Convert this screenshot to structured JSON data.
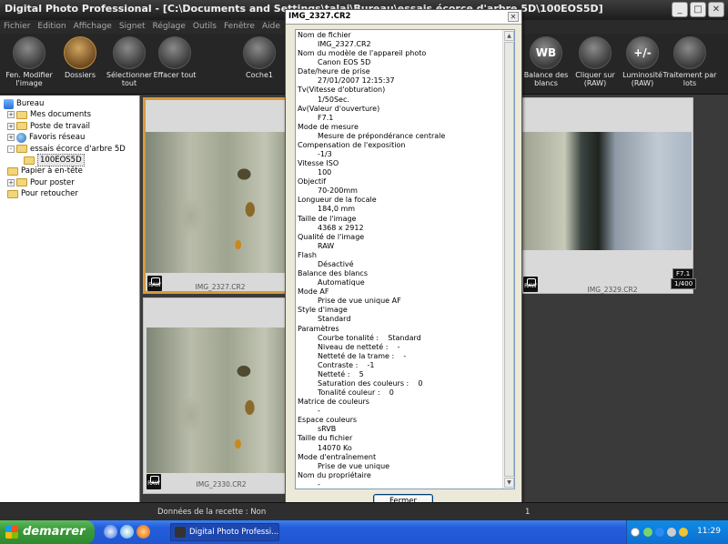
{
  "window": {
    "title": "Digital Photo Professional - [C:\\Documents and Settings\\talai\\Bureau\\essais écorce d'arbre 5D\\100EOS5D]"
  },
  "menu": [
    "Fichier",
    "Edition",
    "Affichage",
    "Signet",
    "Réglage",
    "Outils",
    "Fenêtre",
    "Aide"
  ],
  "toolbar": [
    {
      "label": "Fen. Modifier l'image",
      "icon": "edit-image-icon"
    },
    {
      "label": "Dossiers",
      "icon": "folders-icon"
    },
    {
      "label": "Sélectionner tout",
      "icon": "select-all-icon"
    },
    {
      "label": "Effacer tout",
      "icon": "clear-all-icon"
    },
    {
      "label": "Coche1",
      "icon": "check1-icon"
    },
    {
      "label": "Balance des blancs",
      "icon": "white-balance-icon",
      "glyph": "WB"
    },
    {
      "label": "Cliquer sur (RAW)",
      "icon": "eyedropper-icon"
    },
    {
      "label": "Luminosité (RAW)",
      "icon": "brightness-icon",
      "glyph": "+/-"
    },
    {
      "label": "Traitement par lots",
      "icon": "batch-icon"
    }
  ],
  "tree": [
    {
      "label": "Bureau",
      "icon": "desktop"
    },
    {
      "label": "Mes documents",
      "icon": "folder",
      "toggle": "+"
    },
    {
      "label": "Poste de travail",
      "icon": "folder",
      "toggle": "+"
    },
    {
      "label": "Favoris réseau",
      "icon": "globe",
      "toggle": "+"
    },
    {
      "label": "essais écorce d'arbre 5D",
      "icon": "folder",
      "toggle": "-"
    },
    {
      "label": "100EOS5D",
      "icon": "folder",
      "selected": true
    },
    {
      "label": "Papier à en-tête",
      "icon": "folder"
    },
    {
      "label": "Pour poster",
      "icon": "folder",
      "toggle": "+"
    },
    {
      "label": "Pour retoucher",
      "icon": "folder"
    }
  ],
  "thumbs": [
    {
      "name": "IMG_2327.CR2",
      "raw": "RAW"
    },
    {
      "name": "IMG_2329.CR2",
      "raw": "RAW",
      "aperture": "F7.1",
      "shutter": "1/400"
    },
    {
      "name": "IMG_2330.CR2",
      "raw": "RAW"
    }
  ],
  "dialog": {
    "title": "IMG_2327.CR2",
    "close_label": "Fermer",
    "lines": [
      {
        "t": "l",
        "v": "Nom de fichier"
      },
      {
        "t": "v",
        "v": "IMG_2327.CR2"
      },
      {
        "t": "l",
        "v": "Nom du modèle de l'appareil photo"
      },
      {
        "t": "v",
        "v": "Canon EOS 5D"
      },
      {
        "t": "l",
        "v": "Date/heure de prise"
      },
      {
        "t": "v",
        "v": "27/01/2007 12:15:37"
      },
      {
        "t": "l",
        "v": "Tv(Vitesse d'obturation)"
      },
      {
        "t": "v",
        "v": "1/50Sec."
      },
      {
        "t": "l",
        "v": "Av(Valeur d'ouverture)"
      },
      {
        "t": "v",
        "v": "F7.1"
      },
      {
        "t": "l",
        "v": "Mode de mesure"
      },
      {
        "t": "v",
        "v": "Mesure de prépondérance centrale"
      },
      {
        "t": "l",
        "v": "Compensation de l'exposition"
      },
      {
        "t": "v",
        "v": "-1/3"
      },
      {
        "t": "l",
        "v": "Vitesse ISO"
      },
      {
        "t": "v",
        "v": "100"
      },
      {
        "t": "l",
        "v": "Objectif"
      },
      {
        "t": "v",
        "v": "70-200mm"
      },
      {
        "t": "l",
        "v": "Longueur de la focale"
      },
      {
        "t": "v",
        "v": "184,0 mm"
      },
      {
        "t": "l",
        "v": "Taille de l'image"
      },
      {
        "t": "v",
        "v": "4368 x 2912"
      },
      {
        "t": "l",
        "v": "Qualité de l'image"
      },
      {
        "t": "v",
        "v": "RAW"
      },
      {
        "t": "l",
        "v": "Flash"
      },
      {
        "t": "v",
        "v": "Désactivé"
      },
      {
        "t": "l",
        "v": "Balance des blancs"
      },
      {
        "t": "v",
        "v": "Automatique"
      },
      {
        "t": "l",
        "v": "Mode AF"
      },
      {
        "t": "v",
        "v": "Prise de vue unique AF"
      },
      {
        "t": "l",
        "v": "Style d'image"
      },
      {
        "t": "v",
        "v": "Standard"
      },
      {
        "t": "l",
        "v": "Paramètres"
      },
      {
        "t": "v",
        "v": "Courbe tonalité :    Standard"
      },
      {
        "t": "v",
        "v": "Niveau de netteté :    -"
      },
      {
        "t": "v",
        "v": "Netteté de la trame :    -"
      },
      {
        "t": "v",
        "v": "Contraste :    -1"
      },
      {
        "t": "v",
        "v": "Netteté :    5"
      },
      {
        "t": "v",
        "v": "Saturation des couleurs :    0"
      },
      {
        "t": "v",
        "v": "Tonalité couleur :    0"
      },
      {
        "t": "l",
        "v": "Matrice de couleurs"
      },
      {
        "t": "v",
        "v": "-"
      },
      {
        "t": "l",
        "v": "Espace couleurs"
      },
      {
        "t": "v",
        "v": "sRVB"
      },
      {
        "t": "l",
        "v": "Taille du fichier"
      },
      {
        "t": "v",
        "v": "14070 Ko"
      },
      {
        "t": "l",
        "v": "Mode d'entraînement"
      },
      {
        "t": "v",
        "v": "Prise de vue unique"
      },
      {
        "t": "l",
        "v": "Nom du propriétaire"
      },
      {
        "t": "v",
        "v": "-"
      }
    ]
  },
  "status": {
    "recipe": "Données de la recette : Non",
    "count": "1"
  },
  "taskbar": {
    "start": "demarrer",
    "task": "Digital Photo Professi...",
    "clock": "11:29"
  }
}
